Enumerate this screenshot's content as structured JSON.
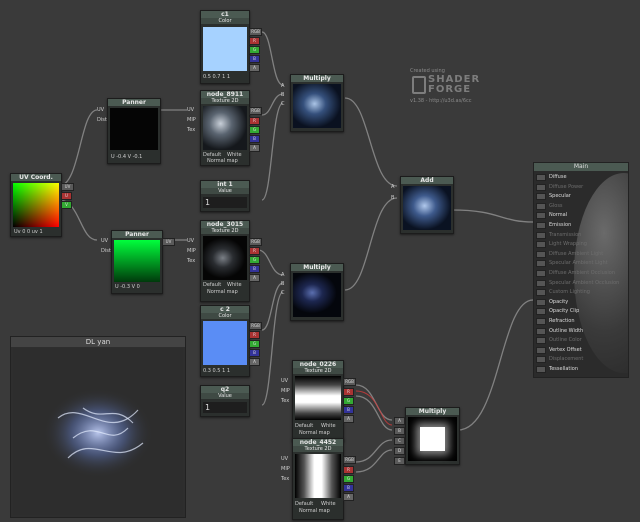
{
  "nodes": {
    "c1": {
      "title": "c1",
      "subtitle": "Color",
      "values": "0.5  0.7  1  1"
    },
    "node_8911": {
      "title": "node_8911",
      "subtitle": "Texture 2D",
      "default": "Default",
      "white": "White",
      "normal": "Normal map"
    },
    "panner1": {
      "title": "Panner",
      "uv": "UV",
      "dist": "Dist",
      "values": "U -0.4   V -0.1"
    },
    "panner2": {
      "title": "Panner",
      "uv": "UV",
      "dist": "Dist",
      "values": "U -0.3   V 0"
    },
    "uvcoord": {
      "title": "UV Coord.",
      "footer": "Uv 0   0   uv   1"
    },
    "int1": {
      "title": "int 1",
      "subtitle": "Value",
      "value": "1"
    },
    "node_3015": {
      "title": "node_3015",
      "subtitle": "Texture 2D",
      "default": "Default",
      "white": "White",
      "normal": "Normal map"
    },
    "c2": {
      "title": "c 2",
      "subtitle": "Color",
      "values": "0.3  0.5  1  1"
    },
    "q2": {
      "title": "q2",
      "subtitle": "Value",
      "value": "1"
    },
    "mult1": {
      "title": "Multiply"
    },
    "mult2": {
      "title": "Multiply"
    },
    "mult3": {
      "title": "Multiply"
    },
    "add": {
      "title": "Add"
    },
    "node_0226": {
      "title": "node_0226",
      "subtitle": "Texture 2D",
      "default": "Default",
      "white": "White",
      "normal": "Normal map"
    },
    "node_4452": {
      "title": "node_4452",
      "subtitle": "Texture 2D",
      "default": "Default",
      "white": "White",
      "normal": "Normal map"
    }
  },
  "ports": {
    "uv": "UV",
    "mip": "MIP",
    "tex": "Tex",
    "rgb": "RGB",
    "r": "R",
    "g": "G",
    "b": "B",
    "a": "A",
    "in_a": "A",
    "in_b": "B",
    "in_c": "C",
    "in_d": "D",
    "in_e": "E",
    "out_u": "U",
    "out_v": "V"
  },
  "logo": {
    "created": "Created using",
    "shader": "SHADER",
    "forge": "FORGE",
    "version": "v1.38  -  http://u3d.as/6cc"
  },
  "preview_panel": {
    "title": "DL yan"
  },
  "main": {
    "title": "Main",
    "rows": [
      {
        "label": "Diffuse",
        "active": true
      },
      {
        "label": "Diffuse Power",
        "active": false
      },
      {
        "label": "Specular",
        "active": true
      },
      {
        "label": "Gloss",
        "active": false
      },
      {
        "label": "Normal",
        "active": true
      },
      {
        "label": "Emission",
        "active": true
      },
      {
        "label": "Transmission",
        "active": false
      },
      {
        "label": "Light Wrapping",
        "active": false
      },
      {
        "label": "Diffuse Ambient Light",
        "active": false
      },
      {
        "label": "Specular Ambient Light",
        "active": false
      },
      {
        "label": "Diffuse Ambient Occlusion",
        "active": false
      },
      {
        "label": "Specular Ambient Occlusion",
        "active": false
      },
      {
        "label": "Custom Lighting",
        "active": false
      },
      {
        "label": "Opacity",
        "active": true
      },
      {
        "label": "Opacity Clip",
        "active": true
      },
      {
        "label": "Refraction",
        "active": true
      },
      {
        "label": "Outline Width",
        "active": true
      },
      {
        "label": "Outline Color",
        "active": false
      },
      {
        "label": "Vertex Offset",
        "active": true
      },
      {
        "label": "Displacement",
        "active": false
      },
      {
        "label": "Tessellation",
        "active": true
      }
    ]
  },
  "colors": {
    "bg": "#3a3a3a",
    "node": "#2b2f2d",
    "header": "#4b5a52",
    "c1": "#a6d2ff",
    "c2": "#5a8df5"
  }
}
